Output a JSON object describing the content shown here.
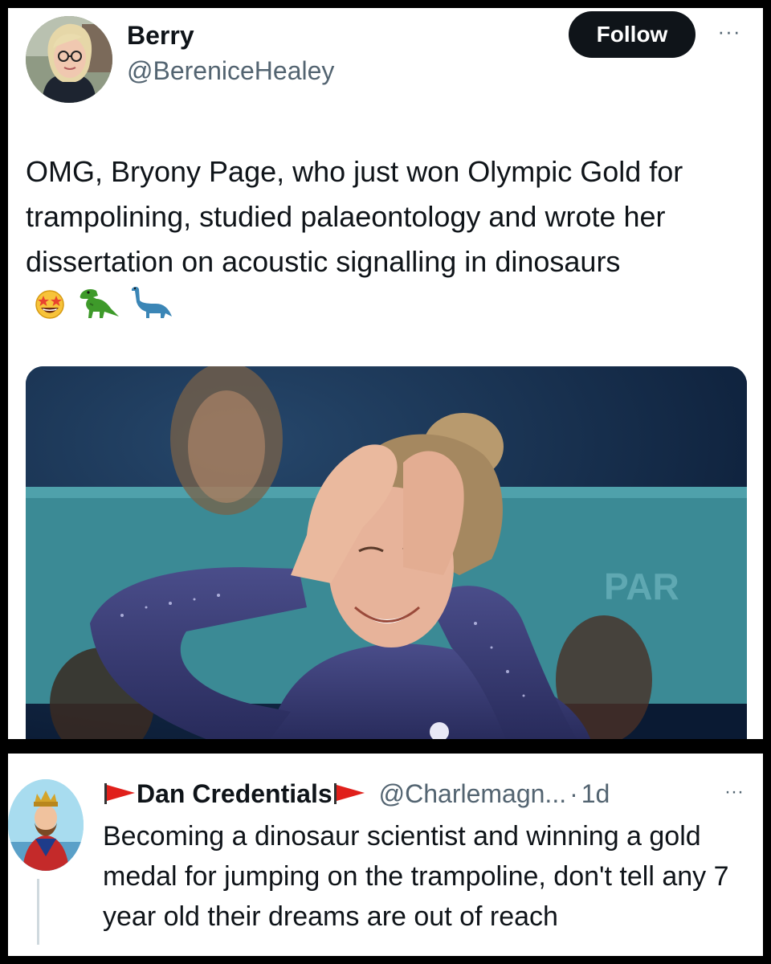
{
  "tweet": {
    "display_name": "Berry",
    "handle": "@BereniceHealey",
    "follow_label": "Follow",
    "more_label": "···",
    "text": "OMG, Bryony Page, who just won Olympic Gold for trampolining, studied palaeontology and wrote her dissertation on acoustic signalling in dinosaurs",
    "emojis": [
      "star-struck-face-icon",
      "t-rex-icon",
      "sauropod-icon"
    ],
    "media_banner_text": "PAR"
  },
  "reply": {
    "display_name": "Dan Credentials",
    "handle": "@Charlemagn...",
    "separator": "·",
    "time": "1d",
    "more_label": "···",
    "text": "Becoming a dinosaur scientist and winning a gold medal for jumping on the trampoline, don't tell any 7 year old their dreams are out of reach"
  },
  "colors": {
    "text_primary": "#0f1419",
    "text_secondary": "#536471",
    "follow_bg": "#0f1419",
    "flag_red": "#e0201b"
  }
}
